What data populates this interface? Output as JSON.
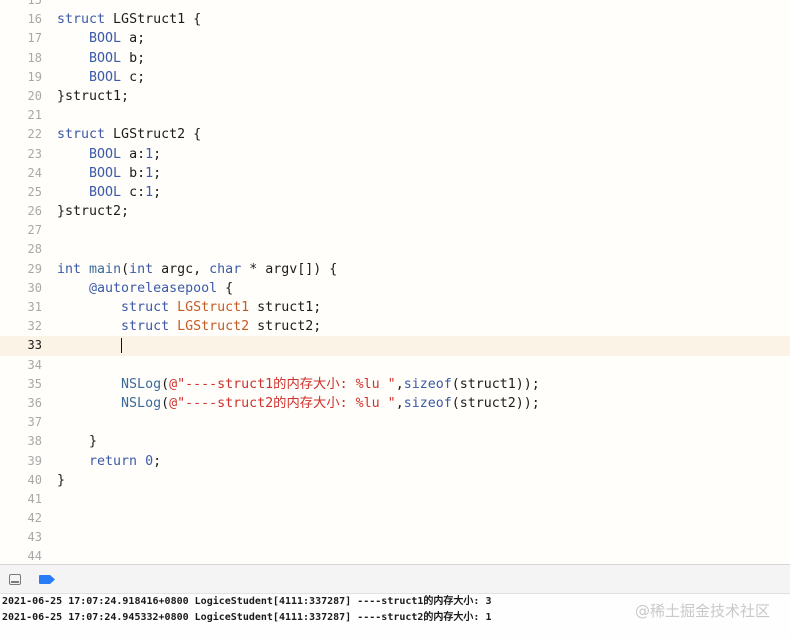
{
  "editor": {
    "current_line": 33,
    "lines": [
      {
        "num": "15",
        "tokens": []
      },
      {
        "num": "16",
        "tokens": [
          {
            "t": "struct",
            "c": "kw"
          },
          {
            "t": " LGStruct1 {"
          }
        ]
      },
      {
        "num": "17",
        "tokens": [
          {
            "t": "    "
          },
          {
            "t": "BOOL",
            "c": "kw"
          },
          {
            "t": " a;"
          }
        ]
      },
      {
        "num": "18",
        "tokens": [
          {
            "t": "    "
          },
          {
            "t": "BOOL",
            "c": "kw"
          },
          {
            "t": " b;"
          }
        ]
      },
      {
        "num": "19",
        "tokens": [
          {
            "t": "    "
          },
          {
            "t": "BOOL",
            "c": "kw"
          },
          {
            "t": " c;"
          }
        ]
      },
      {
        "num": "20",
        "tokens": [
          {
            "t": "}struct1;"
          }
        ]
      },
      {
        "num": "21",
        "tokens": []
      },
      {
        "num": "22",
        "tokens": [
          {
            "t": "struct",
            "c": "kw"
          },
          {
            "t": " LGStruct2 {"
          }
        ]
      },
      {
        "num": "23",
        "tokens": [
          {
            "t": "    "
          },
          {
            "t": "BOOL",
            "c": "kw"
          },
          {
            "t": " a:"
          },
          {
            "t": "1",
            "c": "num"
          },
          {
            "t": ";"
          }
        ]
      },
      {
        "num": "24",
        "tokens": [
          {
            "t": "    "
          },
          {
            "t": "BOOL",
            "c": "kw"
          },
          {
            "t": " b:"
          },
          {
            "t": "1",
            "c": "num"
          },
          {
            "t": ";"
          }
        ]
      },
      {
        "num": "25",
        "tokens": [
          {
            "t": "    "
          },
          {
            "t": "BOOL",
            "c": "kw"
          },
          {
            "t": " c:"
          },
          {
            "t": "1",
            "c": "num"
          },
          {
            "t": ";"
          }
        ]
      },
      {
        "num": "26",
        "tokens": [
          {
            "t": "}struct2;"
          }
        ]
      },
      {
        "num": "27",
        "tokens": []
      },
      {
        "num": "28",
        "tokens": []
      },
      {
        "num": "29",
        "tokens": [
          {
            "t": "int",
            "c": "kw"
          },
          {
            "t": " "
          },
          {
            "t": "main",
            "c": "fn"
          },
          {
            "t": "("
          },
          {
            "t": "int",
            "c": "kw"
          },
          {
            "t": " argc, "
          },
          {
            "t": "char",
            "c": "kw"
          },
          {
            "t": " * argv[]) {"
          }
        ]
      },
      {
        "num": "30",
        "tokens": [
          {
            "t": "    "
          },
          {
            "t": "@autoreleasepool",
            "c": "kw"
          },
          {
            "t": " {"
          }
        ]
      },
      {
        "num": "31",
        "tokens": [
          {
            "t": "        "
          },
          {
            "t": "struct",
            "c": "kw"
          },
          {
            "t": " "
          },
          {
            "t": "LGStruct1",
            "c": "cls"
          },
          {
            "t": " struct1;"
          }
        ]
      },
      {
        "num": "32",
        "tokens": [
          {
            "t": "        "
          },
          {
            "t": "struct",
            "c": "kw"
          },
          {
            "t": " "
          },
          {
            "t": "LGStruct2",
            "c": "cls"
          },
          {
            "t": " struct2;"
          }
        ]
      },
      {
        "num": "33",
        "tokens": [
          {
            "t": "        "
          }
        ],
        "caret": true
      },
      {
        "num": "34",
        "tokens": []
      },
      {
        "num": "35",
        "tokens": [
          {
            "t": "        "
          },
          {
            "t": "NSLog",
            "c": "fn"
          },
          {
            "t": "("
          },
          {
            "t": "@\"----struct1的内存大小: %lu \"",
            "c": "str"
          },
          {
            "t": ","
          },
          {
            "t": "sizeof",
            "c": "kw"
          },
          {
            "t": "(struct1));"
          }
        ]
      },
      {
        "num": "36",
        "tokens": [
          {
            "t": "        "
          },
          {
            "t": "NSLog",
            "c": "fn"
          },
          {
            "t": "("
          },
          {
            "t": "@\"----struct2的内存大小: %lu \"",
            "c": "str"
          },
          {
            "t": ","
          },
          {
            "t": "sizeof",
            "c": "kw"
          },
          {
            "t": "(struct2));"
          }
        ]
      },
      {
        "num": "37",
        "tokens": []
      },
      {
        "num": "38",
        "tokens": [
          {
            "t": "    }"
          }
        ]
      },
      {
        "num": "39",
        "tokens": [
          {
            "t": "    "
          },
          {
            "t": "return",
            "c": "kw"
          },
          {
            "t": " "
          },
          {
            "t": "0",
            "c": "num"
          },
          {
            "t": ";"
          }
        ]
      },
      {
        "num": "40",
        "tokens": [
          {
            "t": "}"
          }
        ]
      },
      {
        "num": "41",
        "tokens": []
      },
      {
        "num": "42",
        "tokens": []
      },
      {
        "num": "43",
        "tokens": []
      },
      {
        "num": "44",
        "tokens": []
      }
    ]
  },
  "debug_bar": {
    "hide_icon": "panel-hide-icon",
    "breakpoint_icon": "breakpoint-icon",
    "accent": "#2a7cf6"
  },
  "console": {
    "lines": [
      "2021-06-25 17:07:24.918416+0800 LogiceStudent[4111:337287] ----struct1的内存大小: 3",
      "2021-06-25 17:07:24.945332+0800 LogiceStudent[4111:337287] ----struct2的内存大小: 1"
    ]
  },
  "watermark": "@稀土掘金技术社区"
}
